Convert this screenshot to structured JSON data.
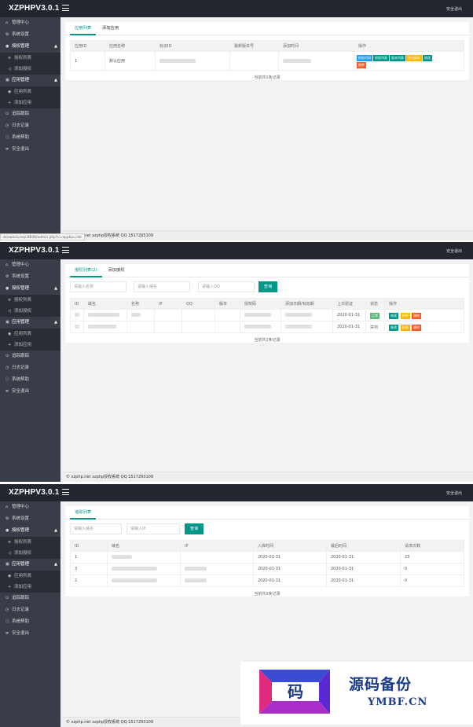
{
  "app": {
    "logo": "XZPHPV3.0.1",
    "logout_top": "安全退出"
  },
  "nav": {
    "dashboard": "管理中心",
    "settings": "系统设置",
    "auth_mgmt": "授权管理",
    "auth_list": "授权列表",
    "add_auth": "添加授权",
    "app_mgmt": "应用管理",
    "app_list": "应用列表",
    "add_app": "添加应用",
    "tracking": "追踪跟踪",
    "logs": "日志记录",
    "help": "系统帮助",
    "logout": "安全退出"
  },
  "footer": "© xzphp.net xzphp授权系统 QQ 1517293109",
  "status_url": "zz/aaexiu.top:8848/admin.php?c=app&a=list",
  "icons": {
    "dashboard": "home-icon",
    "settings": "gear-icon",
    "auth": "key-icon",
    "list": "list-icon",
    "add": "plus-icon",
    "app": "box-icon",
    "track": "eye-icon",
    "logs": "clock-icon",
    "help": "info-icon",
    "logout": "power-icon"
  },
  "colors": {
    "topbar": "#23262e",
    "sidebar": "#393d49",
    "accent": "#009688",
    "blue": "#1e9fff",
    "orange": "#ffb800",
    "red": "#ff5722"
  },
  "s1": {
    "tabs": [
      "应用列表",
      "添加应用"
    ],
    "columns": [
      "应用ID",
      "应用名称",
      "标识ID",
      "最新版本号",
      "添加时间",
      "操作"
    ],
    "row": {
      "id": "1",
      "name": "默认应用"
    },
    "ops": [
      "授权代码",
      "授权列表",
      "版本列表",
      "添加版本",
      "修改",
      "删除"
    ],
    "count": "当前共1条记录"
  },
  "s2": {
    "tabs": [
      "授权列表(2)",
      "添加授权"
    ],
    "filters": {
      "name": "请输入名称",
      "domain": "请输入域名",
      "qq": "请输入QQ",
      "search": "查询"
    },
    "columns": [
      "ID",
      "域名",
      "名称",
      "IP",
      "QQ",
      "版本",
      "授权码",
      "添加日期/有效期",
      "上次验证",
      "状态",
      "操作"
    ],
    "rows": [
      {
        "verify": "2020-01-31",
        "status": "正常"
      },
      {
        "verify": "2020-01-31",
        "status": "禁用"
      }
    ],
    "ops": [
      "修改",
      "封停",
      "删除"
    ],
    "count": "当前共2条记录"
  },
  "s3": {
    "tabs": [
      "追踪列表"
    ],
    "filters": {
      "domain": "请输入域名",
      "ip": "请输入IP",
      "search": "查询"
    },
    "columns": [
      "ID",
      "域名",
      "IP",
      "入库时间",
      "最后时间",
      "请求次数"
    ],
    "rows": [
      {
        "id": "1",
        "in": "2020-01-31",
        "last": "2020-01-31",
        "count": "23"
      },
      {
        "id": "3",
        "in": "2020-01-31",
        "last": "2020-01-31",
        "count": "0"
      },
      {
        "id": "2",
        "in": "2020-01-31",
        "last": "2020-01-31",
        "count": "0"
      }
    ],
    "count": "当前共3条记录"
  },
  "watermark": {
    "glyph": "码",
    "cn": "源码备份",
    "en": "YMBF.CN"
  }
}
